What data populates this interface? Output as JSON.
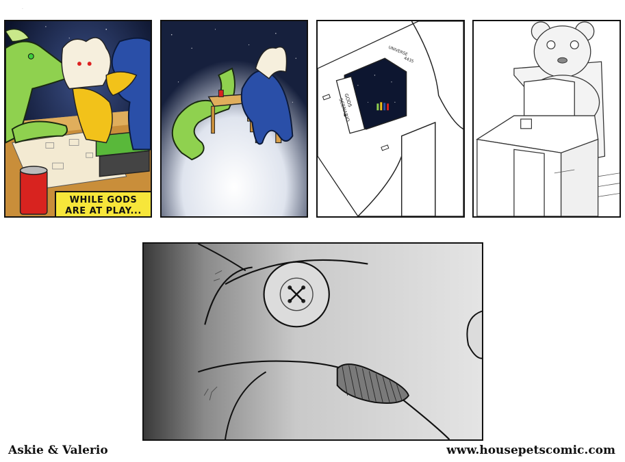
{
  "caption": {
    "line1": "WHILE GODS",
    "line2": "ARE AT PLAY..."
  },
  "box_label": {
    "line1": "GODS",
    "line2": "SCENARIO"
  },
  "box_label_top": "UNIVERSE",
  "box_label_top2": "4435",
  "footer": {
    "left": "Askie & Valerio",
    "right": "www.housepetscomic.com"
  },
  "colors": {
    "space": "#0d1630",
    "dragon_green": "#8fd14f",
    "bird_blue": "#2a4fa8",
    "beak_yellow": "#f2c21a",
    "table_wood": "#d8a04a",
    "can_red": "#d8231f",
    "book_green": "#59b83a",
    "caption_yellow": "#f7e63a"
  }
}
